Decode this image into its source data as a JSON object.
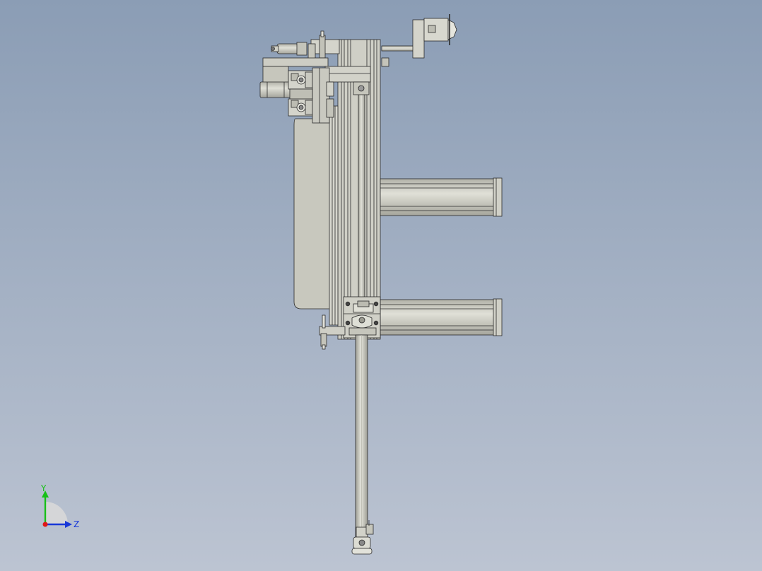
{
  "viewport": {
    "background_top": "#8b9db5",
    "background_bottom": "#bcc4d2"
  },
  "model": {
    "part_fill": "#cbcbc1",
    "part_fill_light": "#dcdcd3",
    "part_fill_dark": "#a9a99f",
    "edge_color": "#2a2a2a"
  },
  "triad": {
    "y_label": "Y",
    "z_label": "Z",
    "y_color": "#18c018",
    "z_color": "#1838d8",
    "origin_color": "#e01818",
    "arc_color": "#d8d8d8"
  }
}
